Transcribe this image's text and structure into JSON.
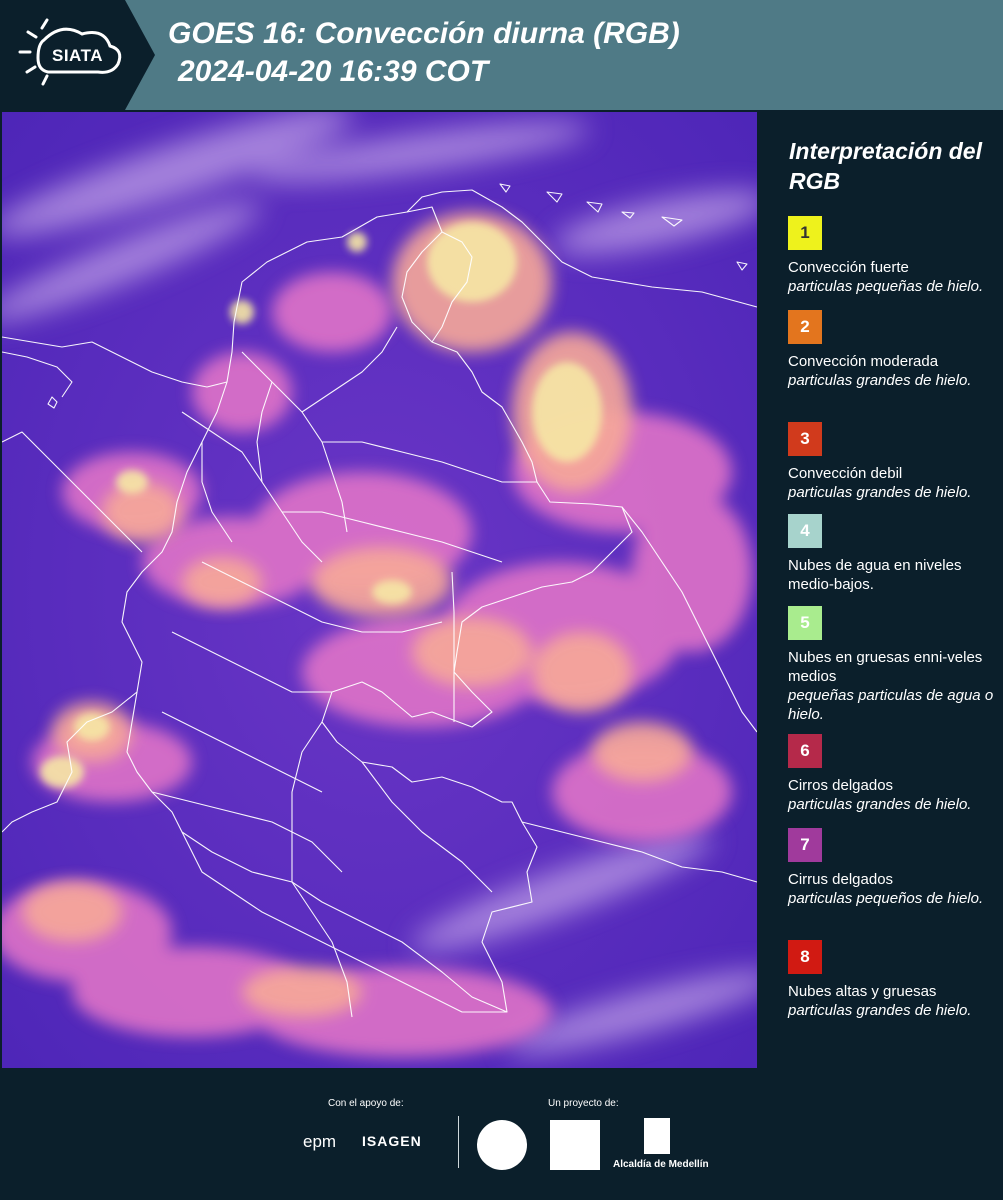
{
  "header": {
    "logo_text": "SIATA",
    "title": "GOES 16: Convección diurna (RGB)",
    "subtitle": "2024-04-20 16:39 COT"
  },
  "legend": {
    "title": "Interpretación del RGB",
    "items": [
      {
        "number": "1",
        "label": "Convección fuerte",
        "desc": "particulas pequeñas de hielo.",
        "color": "#eef21c",
        "text_color": "#333333"
      },
      {
        "number": "2",
        "label": "Convección moderada",
        "desc": "particulas grandes de hielo.",
        "color": "#e3751e",
        "text_color": "#ffffff"
      },
      {
        "number": "3",
        "label": "Convección debil",
        "desc": "particulas grandes de hielo.",
        "color": "#d13a1c",
        "text_color": "#ffffff"
      },
      {
        "number": "4",
        "label": "Nubes de agua en niveles medio-bajos.",
        "desc": "",
        "color": "#a7d3cc",
        "text_color": "#ffffff"
      },
      {
        "number": "5",
        "label": "Nubes en gruesas enni-veles medios",
        "desc": "pequeñas particulas de agua o hielo.",
        "color": "#a9ec8e",
        "text_color": "#ffffff"
      },
      {
        "number": "6",
        "label": "Cirros delgados",
        "desc": "particulas grandes de hielo.",
        "color": "#b5294a",
        "text_color": "#ffffff"
      },
      {
        "number": "7",
        "label": "Cirrus delgados",
        "desc": "particulas pequeños de hielo.",
        "color": "#a03a9c",
        "text_color": "#ffffff"
      },
      {
        "number": "8",
        "label": "Nubes altas y gruesas",
        "desc": "particulas grandes de hielo.",
        "color": "#d11a12",
        "text_color": "#ffffff"
      }
    ]
  },
  "footer": {
    "support_label": "Con el apoyo de:",
    "project_label": "Un proyecto de:",
    "sponsor_epm": "epm",
    "sponsor_isagen": "ISAGEN",
    "alcaldia_label": "Alcaldía de Medellín"
  },
  "colors": {
    "header_bg": "#4f7a86",
    "panel_bg": "#0b1f2b",
    "map_base": "#5a2fc0"
  }
}
